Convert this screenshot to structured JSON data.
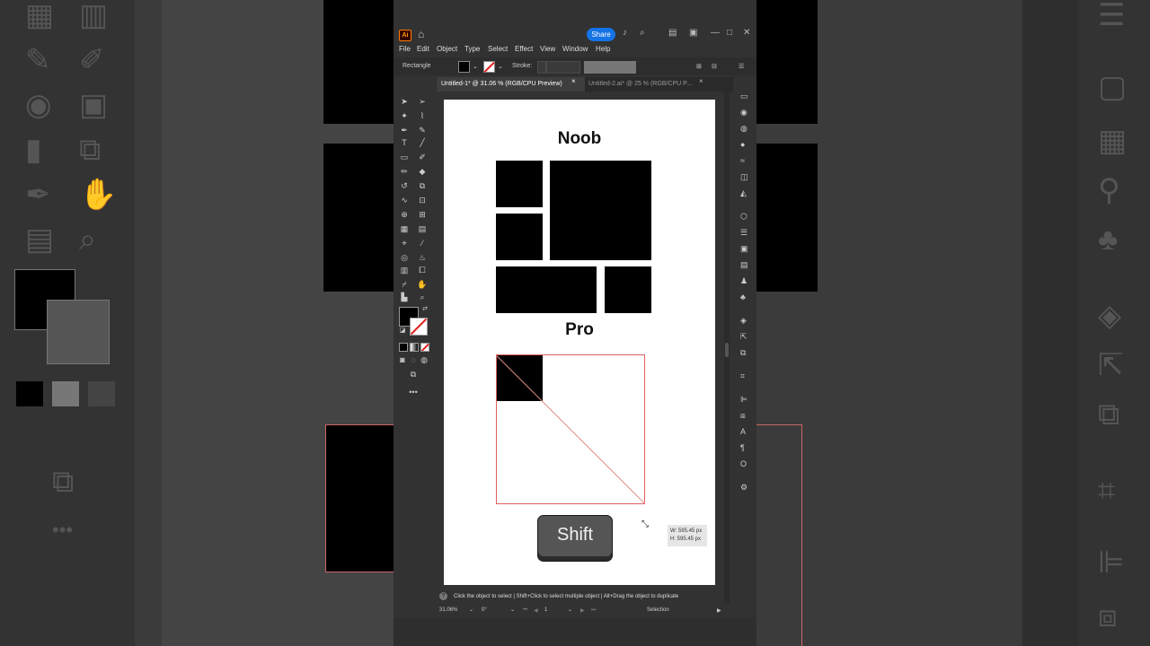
{
  "title_bar": {
    "app_logo": "Ai",
    "share_label": "Share"
  },
  "menu": [
    "File",
    "Edit",
    "Object",
    "Type",
    "Select",
    "Effect",
    "View",
    "Window",
    "Help"
  ],
  "control_bar": {
    "object_type": "Rectangle",
    "stroke_label": "Stroke:"
  },
  "tabs": [
    {
      "label": "Untitled-1* @ 31.06 % (RGB/CPU Preview)",
      "close": "×"
    },
    {
      "label": "Untitled-2.ai* @ 25 % (RGB/CPU P...",
      "close": "×"
    }
  ],
  "artboard": {
    "noob_title": "Noob",
    "pro_title": "Pro",
    "shift_key": "Shift",
    "dim_w": "W: 595.45 px",
    "dim_h": "H: 595.45 px"
  },
  "hint": {
    "text": "Click the object to select  |  Shift+Click to select multiple object  |  Alt+Drag the object to duplicate"
  },
  "status": {
    "zoom": "31.06%",
    "rotation": "0°",
    "artboard_num": "1",
    "mode": "Selection"
  },
  "colors": {
    "accent": "#1473e6",
    "selection": "#e06060",
    "ai_orange": "#ff9a00"
  }
}
